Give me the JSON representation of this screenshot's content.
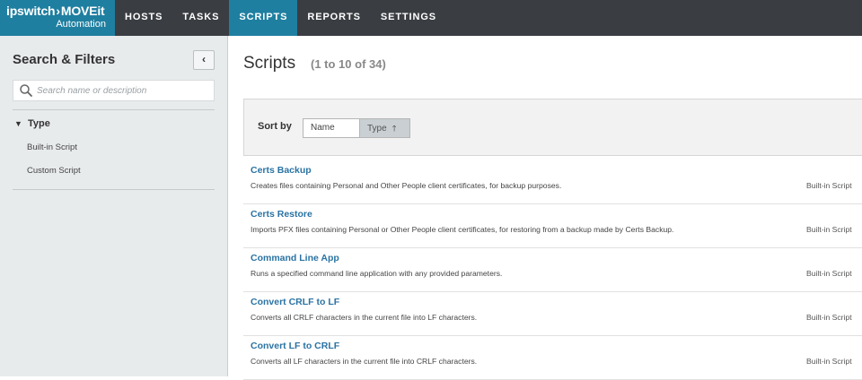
{
  "header": {
    "brand": "ipswitch",
    "product": "MOVEit",
    "product_sub": "Automation",
    "nav": [
      {
        "label": "HOSTS",
        "active": false
      },
      {
        "label": "TASKS",
        "active": false
      },
      {
        "label": "SCRIPTS",
        "active": true
      },
      {
        "label": "REPORTS",
        "active": false
      },
      {
        "label": "SETTINGS",
        "active": false
      }
    ]
  },
  "sidebar": {
    "title": "Search & Filters",
    "collapse_icon": "chevron-left-icon",
    "search_placeholder": "Search name or description",
    "search_value": "",
    "filter_group": "Type",
    "filter_options": [
      "Built-in Script",
      "Custom Script"
    ]
  },
  "main": {
    "title": "Scripts",
    "count": "(1 to 10 of 34)",
    "sort_label": "Sort by",
    "sort_options": [
      {
        "label": "Name",
        "active": false
      },
      {
        "label": "Type",
        "active": true,
        "direction_icon": "arrow-up-icon"
      }
    ],
    "scripts": [
      {
        "name": "Certs Backup",
        "description": "Creates files containing Personal and Other People client certificates, for backup purposes.",
        "type": "Built-in Script"
      },
      {
        "name": "Certs Restore",
        "description": "Imports PFX files containing Personal or Other People client certificates, for restoring from a backup made by Certs Backup.",
        "type": "Built-in Script"
      },
      {
        "name": "Command Line App",
        "description": "Runs a specified command line application with any provided parameters.",
        "type": "Built-in Script"
      },
      {
        "name": "Convert CRLF to LF",
        "description": "Converts all CRLF characters in the current file into LF characters.",
        "type": "Built-in Script"
      },
      {
        "name": "Convert LF to CRLF",
        "description": "Converts all LF characters in the current file into CRLF characters.",
        "type": "Built-in Script"
      }
    ]
  },
  "colors": {
    "topbar": "#3a3d42",
    "accent": "#1f7fa0",
    "link": "#2a73a3",
    "sidebar_bg": "#e8ebec"
  }
}
